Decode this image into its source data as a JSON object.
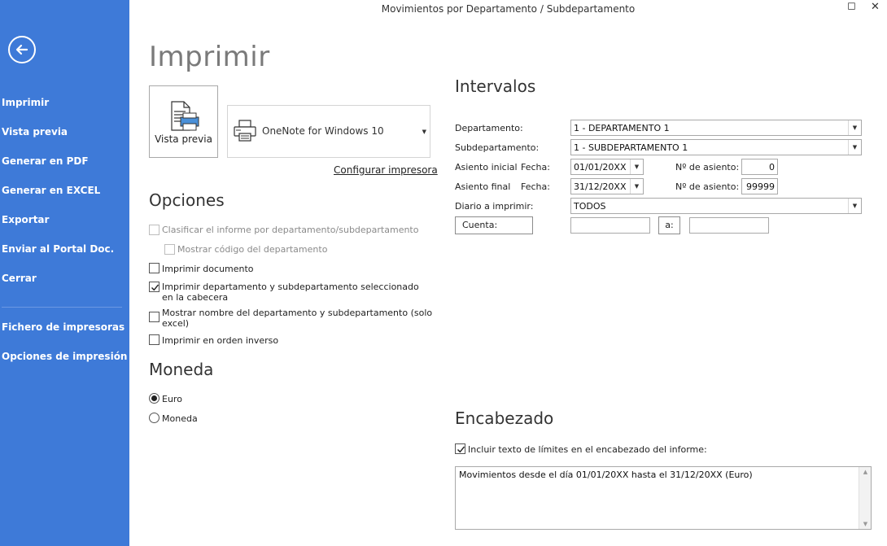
{
  "window": {
    "title": "Movimientos por Departamento / Subdepartamento",
    "maximize_glyph": "◻",
    "close_glyph": "✕"
  },
  "sidebar": {
    "background": "#3e7ad8",
    "back_icon": "back-arrow-icon",
    "items": [
      {
        "label": "Imprimir"
      },
      {
        "label": "Vista previa"
      },
      {
        "label": "Generar en PDF"
      },
      {
        "label": "Generar en EXCEL"
      },
      {
        "label": "Exportar"
      },
      {
        "label": "Enviar al Portal Doc."
      },
      {
        "label": "Cerrar"
      },
      {
        "label": "Fichero de impresoras"
      },
      {
        "label": "Opciones de impresión"
      }
    ]
  },
  "main": {
    "title": "Imprimir",
    "preview_button": "Vista previa",
    "printer": {
      "name": "OneNote for Windows 10"
    },
    "config_link": "Configurar impresora"
  },
  "options": {
    "heading": "Opciones",
    "items": [
      {
        "label": "Clasificar el informe por departamento/subdepartamento",
        "checked": false,
        "disabled": true
      },
      {
        "label": "Mostrar código del departamento",
        "checked": false,
        "disabled": true
      },
      {
        "label": "Imprimir documento",
        "checked": false,
        "disabled": false
      },
      {
        "label": "Imprimir departamento y subdepartamento seleccionado",
        "label2": "en la cabecera",
        "checked": true,
        "disabled": false
      },
      {
        "label": "Mostrar nombre del departamento y subdepartamento (solo",
        "label2": "excel)",
        "checked": false,
        "disabled": false
      },
      {
        "label": "Imprimir en orden inverso",
        "checked": false,
        "disabled": false
      }
    ]
  },
  "currency": {
    "heading": "Moneda",
    "options": [
      {
        "label": "Euro",
        "selected": true
      },
      {
        "label": "Moneda",
        "selected": false
      }
    ]
  },
  "intervals": {
    "heading": "Intervalos",
    "departamento_label": "Departamento:",
    "departamento_value": "1 - DEPARTAMENTO 1",
    "subdepartamento_label": "Subdepartamento:",
    "subdepartamento_value": "1 - SUBDEPARTAMENTO 1",
    "asiento_inicial_label": "Asiento inicial",
    "asiento_final_label": "Asiento final",
    "fecha_label": "Fecha:",
    "fecha_inicial": "01/01/20XX",
    "fecha_final": "31/12/20XX",
    "num_asiento_label": "Nº de asiento:",
    "num_asiento_inicial": "0",
    "num_asiento_final": "99999",
    "diario_label": "Diario a imprimir:",
    "diario_value": "TODOS",
    "cuenta_button": "Cuenta:",
    "a_button": "a:",
    "cuenta_from": "",
    "cuenta_to": ""
  },
  "header": {
    "heading": "Encabezado",
    "include_label": "Incluir texto de límites en el encabezado del informe:",
    "include_checked": true,
    "text": "Movimientos desde el día 01/01/20XX hasta el 31/12/20XX (Euro)"
  }
}
